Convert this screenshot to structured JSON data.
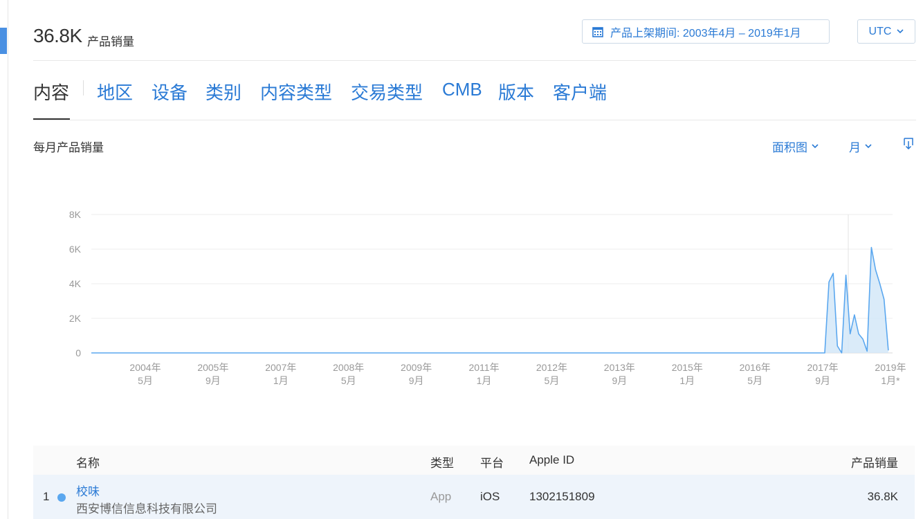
{
  "header": {
    "total_value": "36.8K",
    "total_label": "产品销量",
    "date_range": "产品上架期间: 2003年4月 – 2019年1月",
    "timezone": "UTC"
  },
  "tabs": [
    "内容",
    "地区",
    "设备",
    "类别",
    "内容类型",
    "交易类型",
    "CMB",
    "版本",
    "客户端"
  ],
  "chart_section": {
    "title": "每月产品销量",
    "chart_type_label": "面积图",
    "period_label": "月"
  },
  "chart_data": {
    "type": "area",
    "title": "",
    "xlabel": "",
    "ylabel": "",
    "ylim": [
      0,
      8000
    ],
    "y_ticks": [
      "0",
      "2K",
      "4K",
      "6K",
      "8K"
    ],
    "x_ticks": [
      [
        "2004年",
        "5月"
      ],
      [
        "2005年",
        "9月"
      ],
      [
        "2007年",
        "1月"
      ],
      [
        "2008年",
        "5月"
      ],
      [
        "2009年",
        "9月"
      ],
      [
        "2011年",
        "1月"
      ],
      [
        "2012年",
        "5月"
      ],
      [
        "2013年",
        "9月"
      ],
      [
        "2015年",
        "1月"
      ],
      [
        "2016年",
        "5月"
      ],
      [
        "2017年",
        "9月"
      ],
      [
        "2019年",
        "1月*"
      ]
    ],
    "x_range": [
      "2003-04",
      "2019-01"
    ],
    "grid": true,
    "colors": {
      "line": "#5aa7ef",
      "fill": "#d3e7f8"
    },
    "series": [
      {
        "points": [
          [
            "2003-04",
            0
          ],
          [
            "2017-09",
            0
          ],
          [
            "2017-10",
            4100
          ],
          [
            "2017-11",
            4600
          ],
          [
            "2017-12",
            400
          ],
          [
            "2018-01",
            0
          ],
          [
            "2018-02",
            4500
          ],
          [
            "2018-03",
            1100
          ],
          [
            "2018-04",
            2200
          ],
          [
            "2018-05",
            1100
          ],
          [
            "2018-06",
            800
          ],
          [
            "2018-07",
            100
          ],
          [
            "2018-08",
            6100
          ],
          [
            "2018-09",
            4800
          ],
          [
            "2018-10",
            4000
          ],
          [
            "2018-11",
            3100
          ],
          [
            "2018-12",
            150
          ]
        ]
      }
    ]
  },
  "table": {
    "columns": [
      "名称",
      "类型",
      "平台",
      "Apple ID",
      "产品销量"
    ],
    "rows": [
      {
        "rank": "1",
        "name": "校味",
        "developer": "西安博信信息科技有限公司",
        "type": "App",
        "platform": "iOS",
        "apple_id": "1302151809",
        "sales": "36.8K"
      }
    ]
  }
}
